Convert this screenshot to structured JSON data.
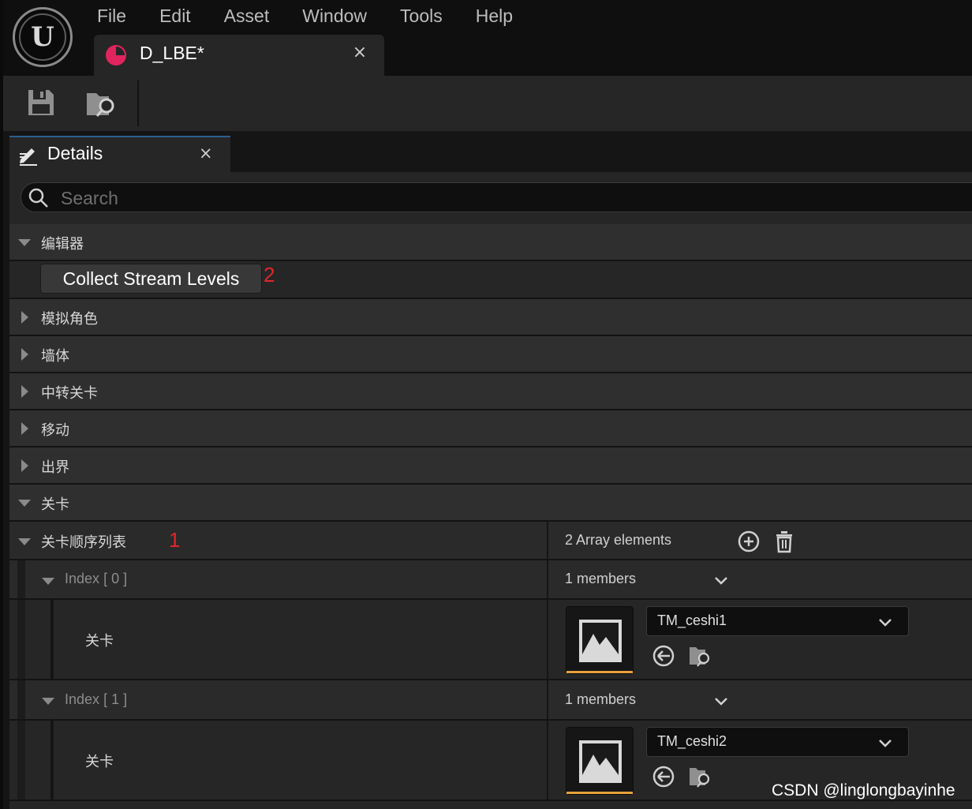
{
  "app": {
    "logo": "unreal-engine-logo",
    "logo_text": "U"
  },
  "menu": [
    "File",
    "Edit",
    "Asset",
    "Window",
    "Tools",
    "Help"
  ],
  "document_tab": {
    "title": "D_LBE*",
    "icon": "data-asset-icon",
    "close": "×"
  },
  "toolbar": {
    "save_icon": "save-icon",
    "browse_icon": "browse-asset-icon"
  },
  "details": {
    "tab_label": "Details",
    "tab_close": "×",
    "search_placeholder": "Search",
    "editor_category": "编辑器",
    "collect_button": "Collect Stream Levels",
    "annotation_2": "2",
    "categories": [
      "模拟角色",
      "墙体",
      "中转关卡",
      "移动",
      "出界"
    ],
    "level_category": "关卡",
    "array": {
      "label": "关卡顺序列表",
      "annotation_1": "1",
      "value": "2 Array elements",
      "elements": [
        {
          "index_label": "Index",
          "index_value": "[ 0 ]",
          "members": "1 members",
          "field_label": "关卡",
          "asset": "TM_ceshi1"
        },
        {
          "index_label": "Index",
          "index_value": "[ 1 ]",
          "members": "1 members",
          "field_label": "关卡",
          "asset": "TM_ceshi2"
        }
      ]
    }
  },
  "colors": {
    "accent_orange": "#e8a13a",
    "annotation_red": "#e0262b",
    "asset_icon": "#e0245e"
  },
  "watermark": "CSDN @linglongbayinhe"
}
